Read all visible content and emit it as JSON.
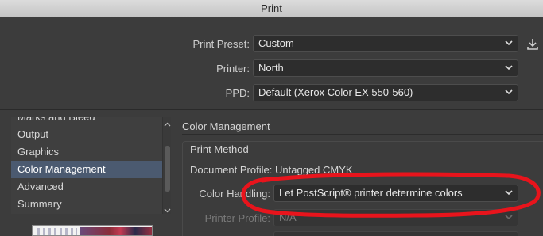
{
  "window": {
    "title": "Print"
  },
  "print_preset": {
    "label": "Print Preset:",
    "value": "Custom"
  },
  "printer": {
    "label": "Printer:",
    "value": "North"
  },
  "ppd": {
    "label": "PPD:",
    "value": "Default (Xerox Color EX 550-560)"
  },
  "sidebar": {
    "items": [
      {
        "label": "Marks and Bleed",
        "selected": false
      },
      {
        "label": "Output",
        "selected": false
      },
      {
        "label": "Graphics",
        "selected": false
      },
      {
        "label": "Color Management",
        "selected": true
      },
      {
        "label": "Advanced",
        "selected": false
      },
      {
        "label": "Summary",
        "selected": false
      }
    ]
  },
  "color_management": {
    "section_title": "Color Management",
    "print_method_title": "Print Method",
    "document_profile": {
      "label": "Document Profile:",
      "value": "Untagged CMYK"
    },
    "color_handling": {
      "label": "Color Handling:",
      "value": "Let PostScript® printer determine colors"
    },
    "printer_profile": {
      "label": "Printer Profile:",
      "value": "N/A"
    }
  },
  "colors": {
    "accent_selected": "#4b5a70",
    "annotation_red": "#e8141c"
  }
}
